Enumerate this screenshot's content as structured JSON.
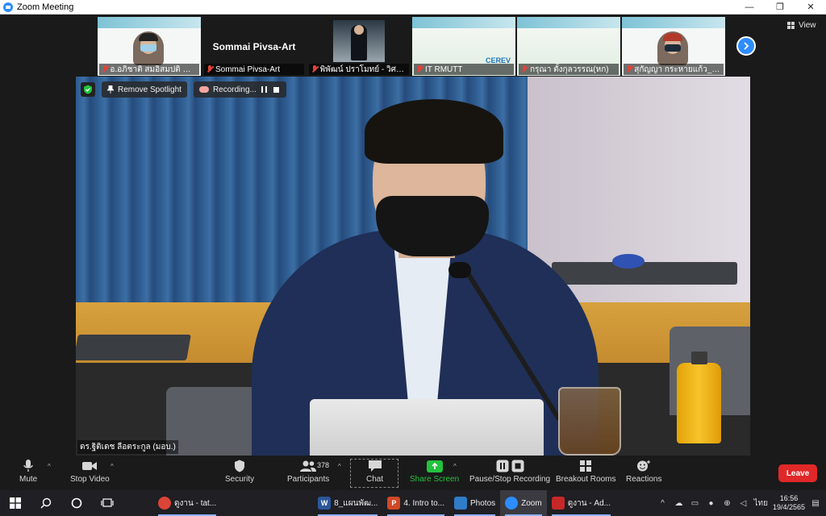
{
  "window": {
    "title": "Zoom Meeting",
    "minimize": "—",
    "maximize": "❐",
    "close": "✕"
  },
  "top_right": {
    "view_label": "View"
  },
  "thumbnails": [
    {
      "name": "อ.อภิชาติ สมอิสมปติ สำนั..."
    },
    {
      "name": "Sommai Pivsa-Art"
    },
    {
      "name": "พิพัฒน์ ปราโมทย์ - วิศวก..."
    },
    {
      "name": "IT RMUTT",
      "logo": "CEREV"
    },
    {
      "name": "กรุณา ตั้งกุลวรรณ(หก)"
    },
    {
      "name": "สุกัญญา กระหายแก้ว_ สวจ."
    }
  ],
  "main_video": {
    "remove_spotlight": "Remove Spotlight",
    "recording": "Recording...",
    "speaker": "ดร.ฐิติเดช ลือตระกูล (มอบ.)"
  },
  "toolbar": {
    "mute": "Mute",
    "stop_video": "Stop Video",
    "security": "Security",
    "participants": "Participants",
    "participants_count": "378",
    "chat": "Chat",
    "share_screen": "Share Screen",
    "pause_stop_recording": "Pause/Stop Recording",
    "breakout_rooms": "Breakout Rooms",
    "reactions": "Reactions",
    "leave": "Leave"
  },
  "taskbar": {
    "apps": [
      {
        "label": "ดูงาน - tat...",
        "icon": "chrome-icon",
        "color": "#db4437"
      },
      {
        "label": "8_แผนพัฒ...",
        "icon": "word-icon",
        "color": "#2b579a"
      },
      {
        "label": "4. Intro to...",
        "icon": "powerpoint-icon",
        "color": "#d24726"
      },
      {
        "label": "Photos",
        "icon": "photos-icon",
        "color": "#2f7cc7"
      },
      {
        "label": "Zoom",
        "icon": "zoom-icon",
        "color": "#2d8cff"
      },
      {
        "label": "ดูงาน - Ad...",
        "icon": "acrobat-icon",
        "color": "#c62828"
      }
    ],
    "language": "ไทย",
    "time": "16:56",
    "date": "19/4/2565"
  }
}
